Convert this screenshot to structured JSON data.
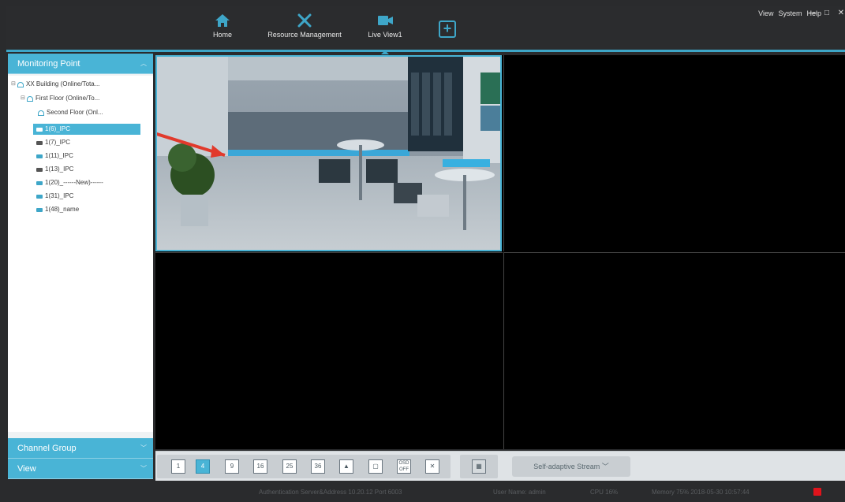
{
  "nav": {
    "home": "Home",
    "resource": "Resource Management",
    "live": "Live View1"
  },
  "menu": {
    "view": "View",
    "system": "System",
    "help": "Help"
  },
  "window": {
    "minimize": "—",
    "maximize": "□",
    "close": "✕"
  },
  "sidebar": {
    "monitoring_title": "Monitoring Point",
    "channel_group_title": "Channel Group",
    "view_title": "View",
    "tree": [
      {
        "label": "XX Building (Online/Tota..."
      },
      {
        "label": "First Floor (Online/To..."
      },
      {
        "label": "Second Floor (Onl..."
      },
      {
        "label": "1(6)_IPC"
      },
      {
        "label": "1(7)_IPC"
      },
      {
        "label": "1(11)_IPC"
      },
      {
        "label": "1(13)_IPC"
      },
      {
        "label": "1(20)_------New)------"
      },
      {
        "label": "1(31)_IPC"
      },
      {
        "label": "1(48)_name"
      }
    ]
  },
  "toolbar": {
    "layouts": [
      "1",
      "4",
      "9",
      "16",
      "25",
      "36"
    ],
    "osd": "OSD OFF",
    "stream": "Self-adaptive Stream"
  },
  "status": {
    "text1": "Authentication Server&Address 10.20.12 Port 6003",
    "text2": "User Name: admin",
    "text3": "CPU 16%",
    "text4": "Memory 75%  2018-05-30 10:57:44"
  },
  "colors": {
    "accent": "#49b4d6",
    "alarm": "#e0141c"
  }
}
